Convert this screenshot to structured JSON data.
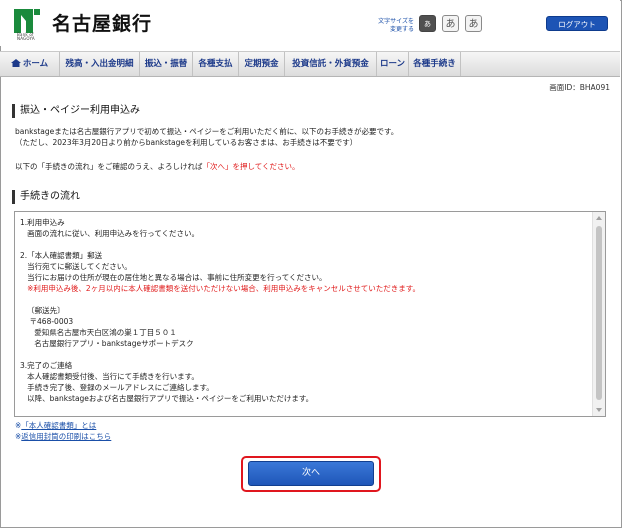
{
  "header": {
    "bank_name": "名古屋銀行",
    "logo_small_text_1": "Bank of",
    "logo_small_text_2": "NAGOYA",
    "font_size_label": "文字サイズを\n変更する",
    "font_buttons": [
      "あ",
      "あ",
      "あ"
    ],
    "logout_label": "ログアウト"
  },
  "nav": {
    "items": [
      "ホーム",
      "残高・入出金明細",
      "振込・振替",
      "各種支払",
      "定期預金",
      "投資信託・外貨預金",
      "ローン",
      "各種手続き"
    ]
  },
  "screen_id": "画面ID：BHA091",
  "section1": {
    "title": "振込・ペイジー利用申込み",
    "desc_line1": "bankstageまたは名古屋銀行アプリで初めて振込・ペイジーをご利用いただく前に、以下のお手続きが必要です。",
    "desc_line2": "（ただし、2023年3月20日より前からbankstageを利用しているお客さまは、お手続きは不要です）",
    "instruction_prefix": "以下の「手続きの流れ」をご確認のうえ、よろしければ",
    "instruction_highlight": "「次へ」を押してください。"
  },
  "section2": {
    "title": "手続きの流れ"
  },
  "flow": {
    "step1": "1.利用申込み\n   画面の流れに従い、利用申込みを行ってください。",
    "step2": "2.「本人確認書類」郵送\n   当行宛てに郵送してください。\n   当行にお届けの住所が現在の居住地と異なる場合は、事前に住所変更を行ってください。",
    "step2_warning": "   ※利用申込み後、2ヶ月以内に本人確認書類を送付いただけない場合、利用申込みをキャンセルさせていただきます。",
    "address": "   〔郵送先〕\n    〒468-0003\n      愛知県名古屋市天白区鴻の巣１丁目５０１\n      名古屋銀行アプリ・bankstageサポートデスク",
    "step3": "3.完了のご連絡\n   本人確認書類受付後、当行にて手続きを行います。\n   手続き完了後、登録のメールアドレスにご連絡します。\n   以降、bankstageおよび名古屋銀行アプリで振込・ペイジーをご利用いただけます。"
  },
  "links": {
    "link1_prefix": "※",
    "link1": "「本人確認書類」とは",
    "link2_prefix": "※",
    "link2": "返信用封筒の印刷はこちら"
  },
  "next_button": "次へ",
  "colors": {
    "accent_blue": "#1d54b5",
    "nav_text": "#1d3a8a",
    "warning_red": "#e01b1b",
    "logo_green": "#1a8a3c"
  }
}
